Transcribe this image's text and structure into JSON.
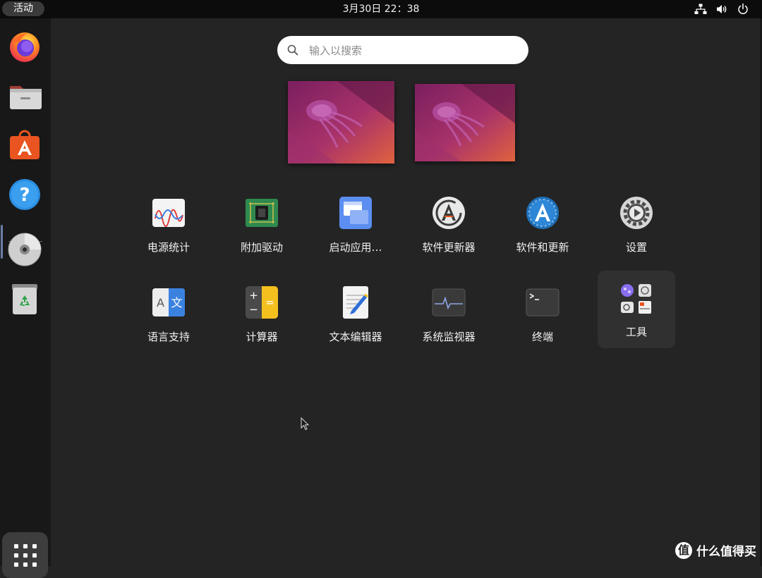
{
  "topbar": {
    "activities_label": "活动",
    "clock": "3月30日  22：38",
    "tray_icons": [
      "network-icon",
      "volume-icon",
      "power-icon"
    ]
  },
  "dock": {
    "apps": [
      "firefox-icon",
      "files-icon",
      "app-center-icon",
      "help-icon",
      "dvd-icon",
      "trash-icon"
    ],
    "show_apps_icon": "app-grid-icon"
  },
  "search": {
    "placeholder": "输入以搜索",
    "value": ""
  },
  "workspaces": [
    "workspace-1",
    "workspace-2"
  ],
  "apps": [
    {
      "label": "电源统计",
      "icon": "power-statistics-icon"
    },
    {
      "label": "附加驱动",
      "icon": "additional-drivers-icon"
    },
    {
      "label": "启动应用…",
      "icon": "startup-applications-icon"
    },
    {
      "label": "软件更新器",
      "icon": "software-updater-icon"
    },
    {
      "label": "软件和更新",
      "icon": "software-properties-icon"
    },
    {
      "label": "设置",
      "icon": "settings-icon"
    },
    {
      "label": "语言支持",
      "icon": "language-support-icon"
    },
    {
      "label": "计算器",
      "icon": "calculator-icon"
    },
    {
      "label": "文本编辑器",
      "icon": "text-editor-icon"
    },
    {
      "label": "系统监视器",
      "icon": "system-monitor-icon"
    },
    {
      "label": "终端",
      "icon": "terminal-icon"
    },
    {
      "label": "工具",
      "icon": "utilities-folder-icon"
    }
  ],
  "colors": {
    "accent": "#e95420",
    "panel": "#0c0c0c",
    "background": "#242424"
  },
  "watermark": {
    "badge": "值",
    "text": "什么值得买"
  }
}
